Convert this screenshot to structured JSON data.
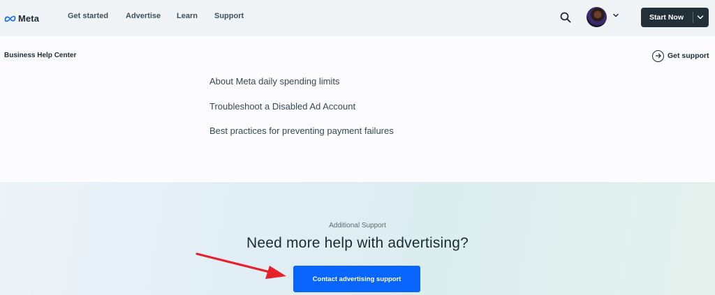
{
  "header": {
    "logo_text": "Meta",
    "nav": [
      {
        "label": "Get started"
      },
      {
        "label": "Advertise"
      },
      {
        "label": "Learn"
      },
      {
        "label": "Support"
      }
    ],
    "search_icon": "search-icon",
    "avatar_icon": "avatar",
    "start_button": {
      "label": "Start Now"
    }
  },
  "subheader": {
    "title": "Business Help Center",
    "get_support": "Get support"
  },
  "articles": [
    {
      "label": "About Meta daily spending limits"
    },
    {
      "label": "Troubleshoot a Disabled Ad Account"
    },
    {
      "label": "Best practices for preventing payment failures"
    }
  ],
  "support": {
    "eyebrow": "Additional Support",
    "headline": "Need more help with advertising?",
    "cta": "Contact advertising support"
  },
  "colors": {
    "cta": "#0866ff",
    "start_button": "#233038",
    "annotation_arrow": "#e8202a"
  }
}
